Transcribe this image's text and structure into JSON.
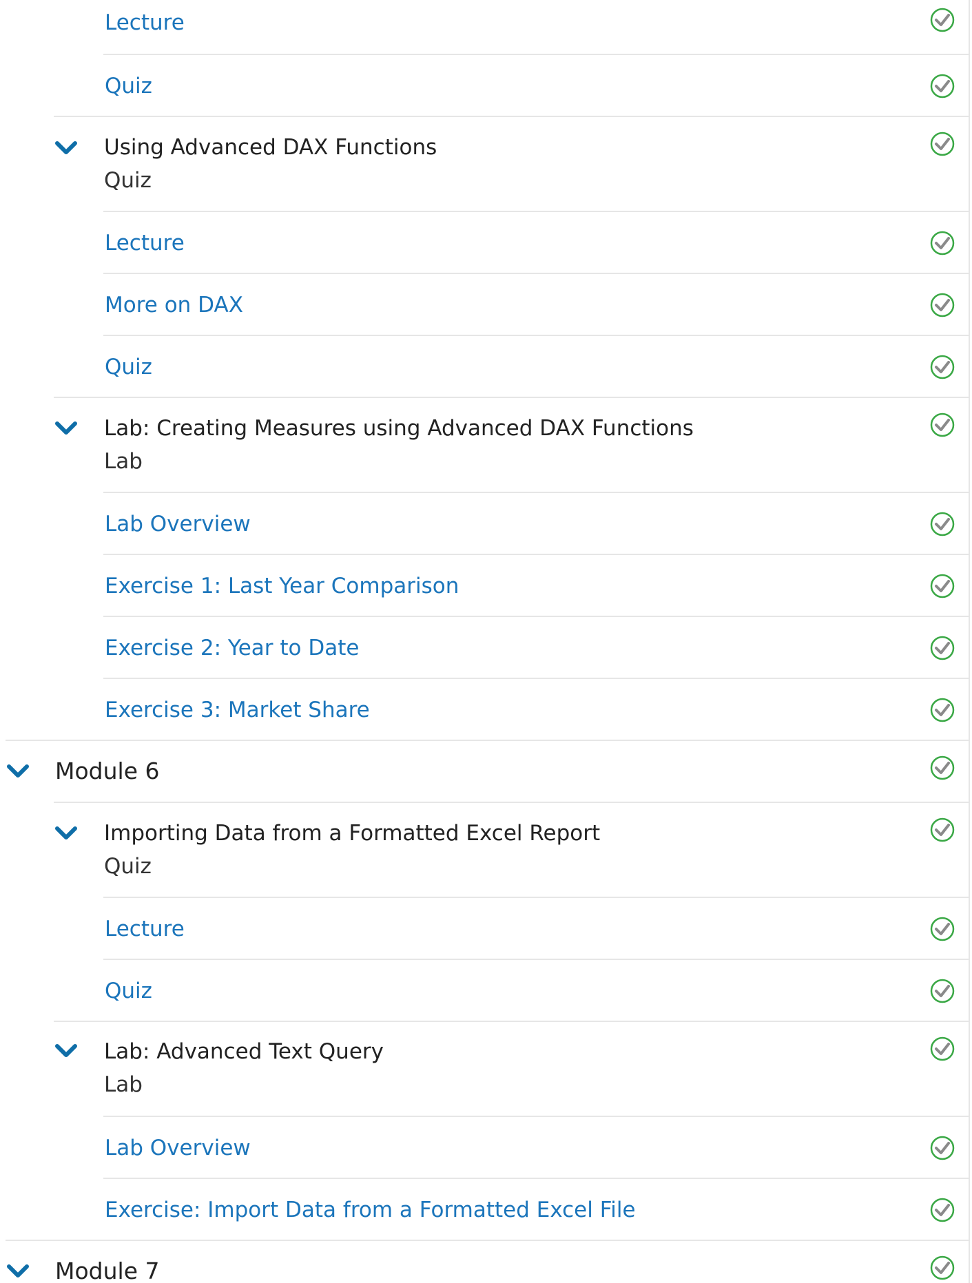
{
  "items": {
    "lecture_top": "Lecture",
    "quiz_top": "Quiz",
    "adv_dax": {
      "title": "Using Advanced DAX Functions",
      "subtitle": "Quiz"
    },
    "adv_dax_lecture": "Lecture",
    "adv_dax_more": "More on DAX",
    "adv_dax_quiz": "Quiz",
    "lab_measures": {
      "title": "Lab: Creating Measures using Advanced DAX Functions",
      "subtitle": "Lab"
    },
    "lab_measures_overview": "Lab Overview",
    "lab_measures_ex1": "Exercise 1: Last Year Comparison",
    "lab_measures_ex2": "Exercise 2: Year to Date",
    "lab_measures_ex3": "Exercise 3: Market Share",
    "module6": "Module 6",
    "import_excel": {
      "title": "Importing Data from a Formatted Excel Report",
      "subtitle": "Quiz"
    },
    "import_excel_lecture": "Lecture",
    "import_excel_quiz": "Quiz",
    "lab_text": {
      "title": "Lab: Advanced Text Query",
      "subtitle": "Lab"
    },
    "lab_text_overview": "Lab Overview",
    "lab_text_ex": "Exercise: Import Data from a Formatted Excel File",
    "module7": "Module 7"
  },
  "icons": {
    "expand": "chevron-down-icon",
    "completed": "check-circle-icon"
  },
  "colors": {
    "link": "#1b75bb",
    "chevron": "#0f6ea8",
    "check_ring": "#3aa845",
    "check_mark": "#8a8a8a",
    "divider": "#e6e6e6"
  }
}
